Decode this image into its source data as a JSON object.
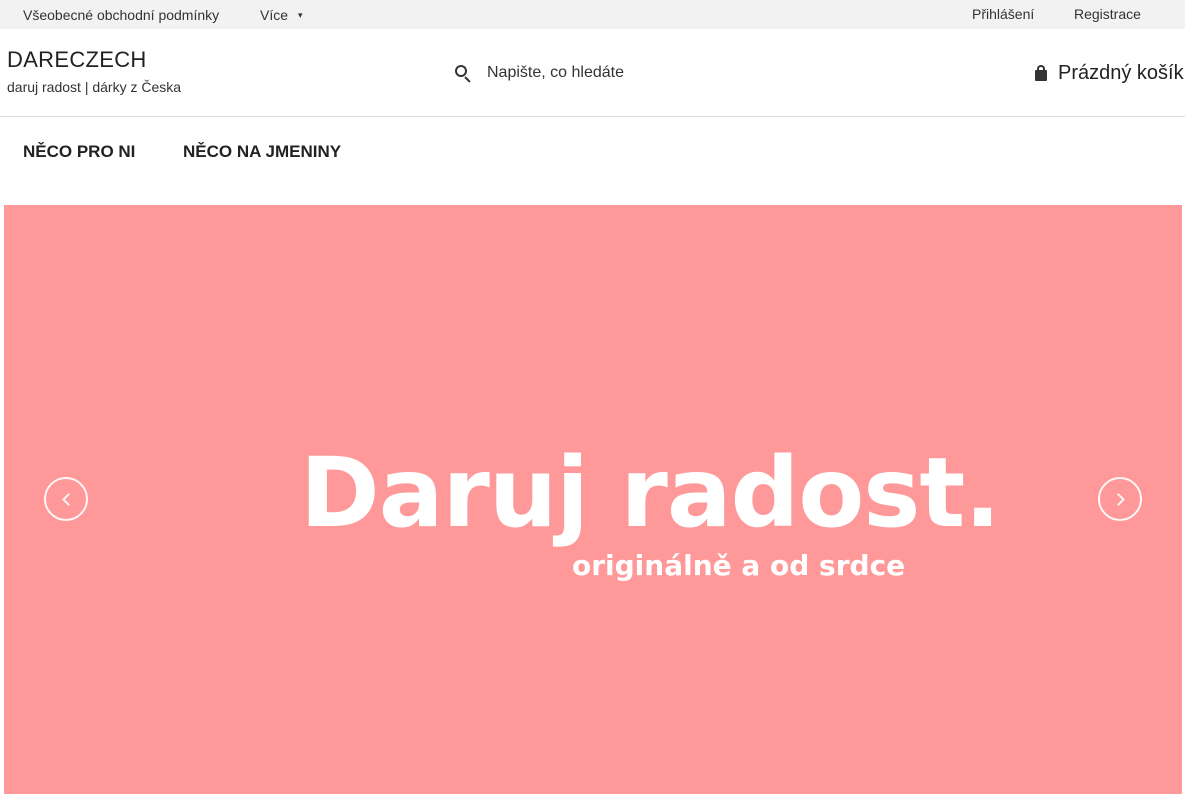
{
  "topbar": {
    "terms_label": "Všeobecné obchodní podmínky",
    "more_label": "Více",
    "more_caret": "▾",
    "login_label": "Přihlášení",
    "register_label": "Registrace"
  },
  "header": {
    "logo_title": "DARECZECH",
    "logo_tagline": "daruj radost | dárky z Česka",
    "search": {
      "placeholder": "Napište, co hledáte",
      "value": "",
      "icon": "search-icon"
    },
    "cart": {
      "label": "Prázdný košík",
      "icon": "bag-icon"
    }
  },
  "nav": {
    "items": [
      {
        "label": "NĚCO PRO NI"
      },
      {
        "label": "NĚCO NA JMENINY"
      }
    ]
  },
  "banner": {
    "headline": "Daruj radost.",
    "subheadline": "originálně a od srdce",
    "background_color": "#ff9999",
    "prev_icon": "chevron-left-icon",
    "next_icon": "chevron-right-icon"
  }
}
